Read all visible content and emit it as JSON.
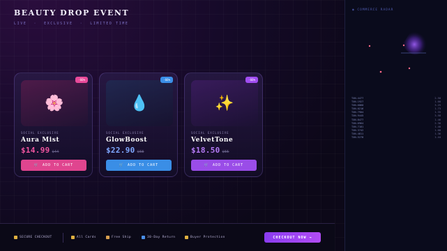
{
  "header": {
    "title": "BEAUTY DROP EVENT",
    "subtitle_items": [
      "LIVE",
      "EXCLUSIVE",
      "LIMITED TIME"
    ]
  },
  "products": [
    {
      "tag": "SOCIAL EXCLUSIVE",
      "name": "Aura Mist",
      "price": "$14.99",
      "old_price": "$44",
      "badge": "-66%",
      "icon": "cherry-blossom",
      "glyph": "🌸",
      "button": "ADD TO CART",
      "accent": "#e84a9a"
    },
    {
      "tag": "SOCIAL EXCLUSIVE",
      "name": "GlowBoost",
      "price": "$22.90",
      "old_price": "$68",
      "badge": "-66%",
      "icon": "droplet",
      "glyph": "💧",
      "button": "ADD TO CART",
      "accent": "#3b8fe8"
    },
    {
      "tag": "SOCIAL EXCLUSIVE",
      "name": "VelvetTone",
      "price": "$18.50",
      "old_price": "$55",
      "badge": "-66%",
      "icon": "sparkles",
      "glyph": "✨",
      "button": "ADD TO CART",
      "accent": "#a04df0"
    }
  ],
  "radar": {
    "title": "◉ COMMERCE RADAR",
    "rows": [
      {
        "id": "TXN-4477",
        "val": "2.50"
      },
      {
        "id": "TXN-1927",
        "val": "1.00"
      },
      {
        "id": "TXN-6860",
        "val": "3.25"
      },
      {
        "id": "TXN-0216",
        "val": "1.73"
      },
      {
        "id": "TXN-7904",
        "val": "1.35"
      },
      {
        "id": "TXN-9445",
        "val": "3.58"
      },
      {
        "id": "TXN-8477",
        "val": "1.46"
      },
      {
        "id": "TXN-6964",
        "val": "2.30"
      },
      {
        "id": "TXN-7181",
        "val": "1.40"
      },
      {
        "id": "TXN-3742",
        "val": "1.08"
      },
      {
        "id": "TXN-4811",
        "val": "1.36"
      },
      {
        "id": "TXN-5278",
        "val": "1.44"
      }
    ]
  },
  "footer": {
    "secure": "SECURE CHECKOUT",
    "badges": [
      {
        "label": "All Cards",
        "icon": "card",
        "color": "#e0b040"
      },
      {
        "label": "Free Ship",
        "icon": "box",
        "color": "#d9a050"
      },
      {
        "label": "30-Day Return",
        "icon": "return",
        "color": "#4a8ee8"
      },
      {
        "label": "Buyer Protection",
        "icon": "lock",
        "color": "#e0b040"
      }
    ],
    "checkout": "CHECKOUT NOW →"
  }
}
